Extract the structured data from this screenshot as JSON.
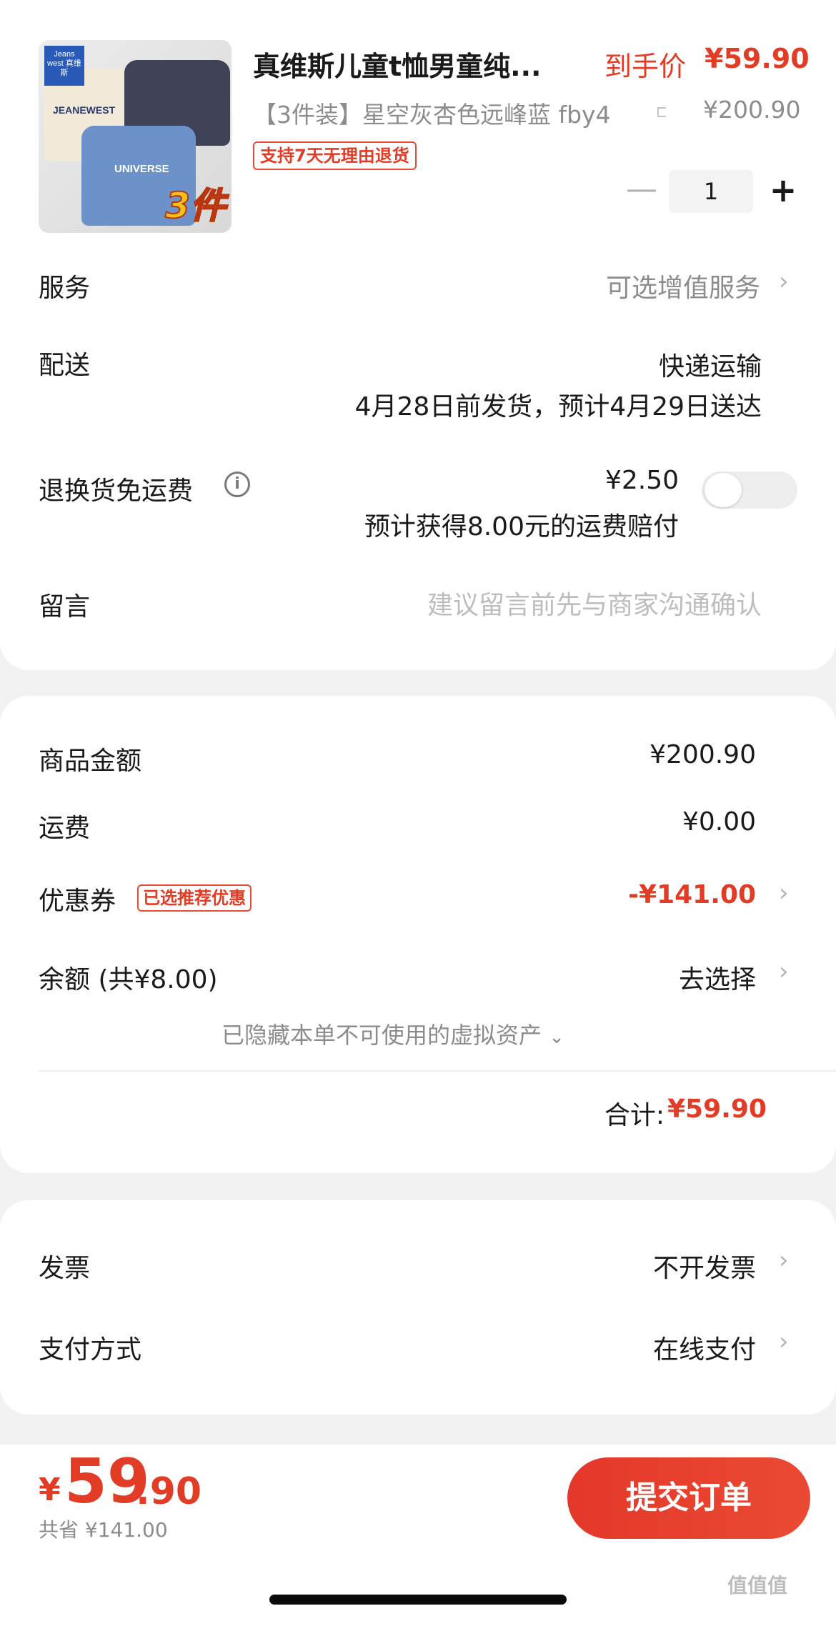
{
  "product": {
    "title": "真维斯儿童t恤男童纯...",
    "final_price_label": "到手价",
    "final_price": "¥59.90",
    "spec": "【3件装】星空灰杏色远峰蓝 fby4",
    "spec_icon": "scan-icon",
    "original_price": "¥200.90",
    "return_badge": "支持7天无理由退货",
    "quantity": "1",
    "minus_icon": "minus-icon",
    "plus_icon": "plus-icon",
    "thumbnail_text": {
      "brand": "Jeans west 真维斯",
      "shirt_1": "JEANEWEST",
      "shirt_2": "UNIVERSE",
      "pack": "3件"
    }
  },
  "service": {
    "label": "服务",
    "value": "可选增值服务"
  },
  "delivery": {
    "label": "配送",
    "method": "快递运输",
    "eta": "4月28日前发货，预计4月29日送达"
  },
  "return_shipping": {
    "label": "退换货免运费",
    "price": "¥2.50",
    "desc": "预计获得8.00元的运费赔付",
    "enabled": false
  },
  "message": {
    "label": "留言",
    "placeholder": "建议留言前先与商家沟通确认"
  },
  "amounts": {
    "goods_label": "商品金额",
    "goods_value": "¥200.90",
    "shipping_label": "运费",
    "shipping_value": "¥0.00",
    "coupon_label": "优惠券",
    "coupon_tag": "已选推荐优惠",
    "coupon_value": "-¥141.00",
    "balance_label": "余额 (共¥8.00)",
    "balance_value": "去选择",
    "hidden_assets": "已隐藏本单不可使用的虚拟资产",
    "total_label": "合计:",
    "total_value": "¥59.90"
  },
  "invoice": {
    "label": "发票",
    "value": "不开发票"
  },
  "payment": {
    "label": "支付方式",
    "value": "在线支付"
  },
  "bottom": {
    "currency": "¥",
    "price_int": "59",
    "price_dec": ".90",
    "saved": "共省 ¥141.00",
    "submit_label": "提交订单"
  },
  "watermark": "值值值",
  "colors": {
    "accent": "#e23c26",
    "muted": "#8c8c8c",
    "background": "#f2f2f2"
  }
}
